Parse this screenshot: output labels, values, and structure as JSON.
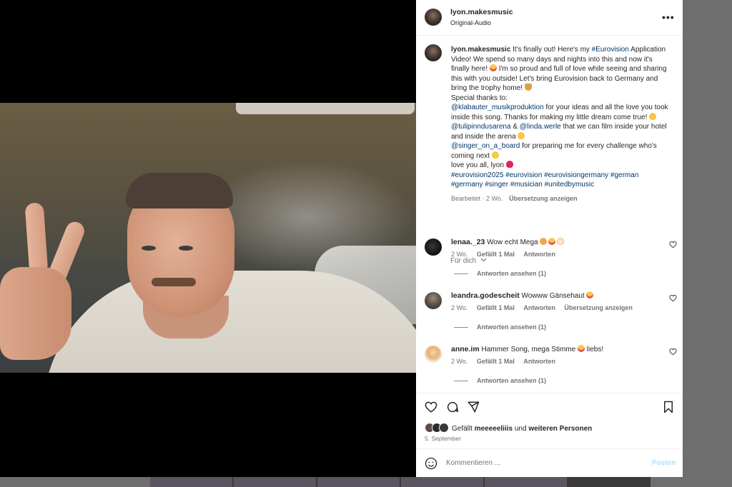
{
  "post": {
    "author": "lyon.makesmusic",
    "audio": "Original-Audio",
    "caption": {
      "author": "lyon.makesmusic",
      "l1": " It's finally out! Here's my ",
      "tag_eurovision": "#Eurovision",
      "l2": " Application Video! We spend so many days and nights into this and now it's finally here! ",
      "l3": " I'm so proud and full of love while seeing and sharing this with you outside! Let's bring Eurovision back to Germany and bring the trophy home! ",
      "thanks": "Special thanks to:",
      "mention1": "@klabauter_musikproduktion",
      "m1_text": " for your ideas and all the love you took inside this song. Thanks for making my little dream come true! ",
      "mention2": "@tulipinndusarena",
      "amp": " & ",
      "mention3": "@linda.werle",
      "m3_text": " that we can film inside your hotel and inside the arena ",
      "mention4": "@singer_on_a_board",
      "m4_text": " for preparing me for every challenge who's coming next ",
      "love": "love you all, lyon ",
      "hashtags": "#eurovision2025 #eurovision #eurovisiongermany #german #germany #singer #musician #unitedbymusic",
      "edited": "Bearbeitet · 2 Wo.",
      "translate": "Übersetzung anzeigen"
    },
    "filter_label": "Für dich",
    "comments": [
      {
        "user": "lenaa._23",
        "text": "Wow echt Mega",
        "time": "2 Wo.",
        "likes": "Gefällt 1 Mal",
        "reply": "Antworten",
        "translate": "",
        "view_replies": "Antworten ansehen (1)"
      },
      {
        "user": "leandra.godescheit",
        "text": "Wowww Gänsehaut",
        "time": "2 Wo.",
        "likes": "Gefällt 1 Mal",
        "reply": "Antworten",
        "translate": "Übersetzung anzeigen",
        "view_replies": "Antworten ansehen (1)"
      },
      {
        "user": "anne.im",
        "text": "Hammer Song, mega Stimme ",
        "text_end": " liebs!",
        "time": "2 Wo.",
        "likes": "Gefällt 1 Mal",
        "reply": "Antworten",
        "translate": "",
        "view_replies": "Antworten ansehen (1)"
      }
    ],
    "liked_by_prefix": "Gefällt ",
    "liked_by_user": "meeeeeliiis",
    "liked_by_and": " und ",
    "liked_by_others": "weiteren Personen",
    "date": "5. September",
    "compose_placeholder": "Kommentieren ...",
    "post_button": "Posten"
  },
  "colors": {
    "link": "#00376b",
    "muted": "#737373",
    "post_disabled": "#b2dffc"
  },
  "icons": [
    "more-icon",
    "volume-icon",
    "heart-icon",
    "comment-icon",
    "share-icon",
    "bookmark-icon",
    "emoji-icon",
    "chevron-down-icon"
  ]
}
